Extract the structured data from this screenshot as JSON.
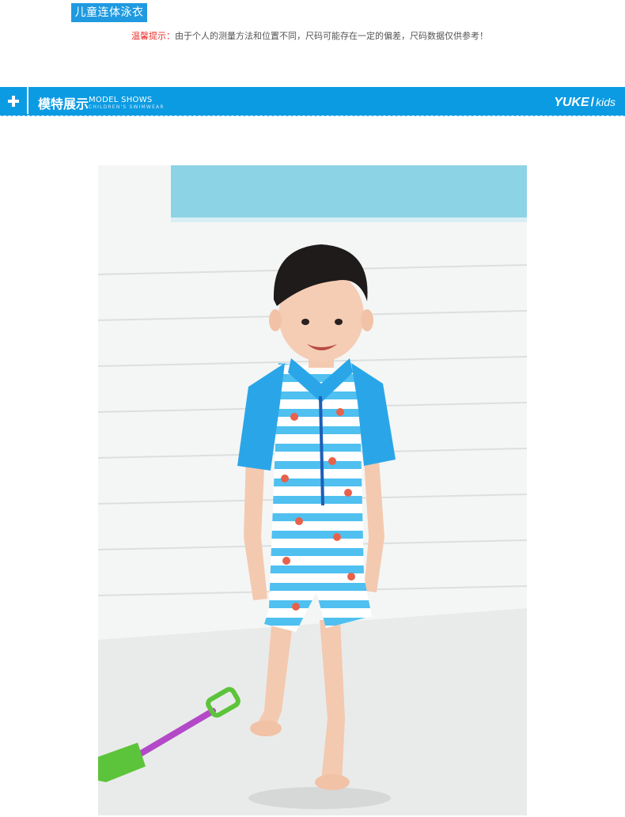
{
  "header": {
    "category_label": "儿童连体泳衣",
    "tip_label": "温馨提示：",
    "tip_text": "由于个人的测量方法和位置不同，尺码可能存在一定的偏差，尺码数据仅供参考！"
  },
  "banner": {
    "title_cn": "模特展示",
    "title_en": "MODEL SHOWS",
    "subtitle_en": "CHILDREN'S SWIMWEAR",
    "brand_main": "YUKE",
    "brand_sep": "/",
    "brand_sub": "kids",
    "plus_icon": "plus-icon"
  },
  "photo": {
    "subject": "child-in-striped-swimsuit",
    "colors": {
      "accent": "#0b9be3",
      "swimsuit_sleeve": "#2aa6e8",
      "stripe": "#4fc0f0",
      "shovel_handle": "#b348c8",
      "shovel_blade": "#5cc43a"
    }
  }
}
